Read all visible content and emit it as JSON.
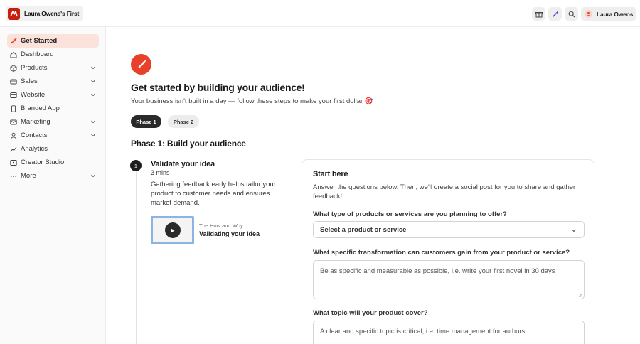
{
  "brand": {
    "name": "Laura Owens's First"
  },
  "user": {
    "name": "Laura Owens"
  },
  "topbar": {
    "icons": [
      "gift-icon",
      "magic-wand-icon",
      "search-icon"
    ]
  },
  "sidebar": {
    "items": [
      {
        "label": "Get Started",
        "icon": "rocket-icon",
        "active": true,
        "expandable": false
      },
      {
        "label": "Dashboard",
        "icon": "home-icon",
        "expandable": false
      },
      {
        "label": "Products",
        "icon": "box-icon",
        "expandable": true
      },
      {
        "label": "Sales",
        "icon": "card-icon",
        "expandable": true
      },
      {
        "label": "Website",
        "icon": "window-icon",
        "expandable": true
      },
      {
        "label": "Branded App",
        "icon": "phone-icon",
        "expandable": false
      },
      {
        "label": "Marketing",
        "icon": "mail-icon",
        "expandable": true
      },
      {
        "label": "Contacts",
        "icon": "person-icon",
        "expandable": true
      },
      {
        "label": "Analytics",
        "icon": "chart-icon",
        "expandable": false
      },
      {
        "label": "Creator Studio",
        "icon": "studio-icon",
        "expandable": false
      },
      {
        "label": "More",
        "icon": "dots-icon",
        "expandable": true
      }
    ]
  },
  "hero": {
    "title": "Get started by building your audience!",
    "subtitle": "Your business isn't built in a day — follow these steps to make your first dollar 🎯"
  },
  "phases": {
    "phase1": "Phase 1",
    "phase2": "Phase 2",
    "active": "Phase 1"
  },
  "phase_title": "Phase 1: Build your audience",
  "step": {
    "number": "1",
    "title": "Validate your idea",
    "time": "3 mins",
    "description": "Gathering feedback early helps tailor your product to customer needs and ensures market demand."
  },
  "video": {
    "kicker": "The How and Why",
    "title": "Validating your Idea"
  },
  "form": {
    "title": "Start here",
    "intro": "Answer the questions below. Then, we'll create a social post for you to share and gather feedback!",
    "q1": {
      "label": "What type of products or services are you planning to offer?",
      "value": "Select a product or service"
    },
    "q2": {
      "label": "What specific transformation can customers gain from your product or service?",
      "placeholder": "Be as specific and measurable as possible, i.e. write your first novel in 30 days"
    },
    "q3": {
      "label": "What topic will your product cover?",
      "placeholder": "A clear and specific topic is critical, i.e. time management for authors"
    }
  },
  "colors": {
    "accent": "#e8402a",
    "active_nav_bg": "#fbe3dc",
    "brand_logo": "#c8200f",
    "dark": "#1e1e1e"
  }
}
